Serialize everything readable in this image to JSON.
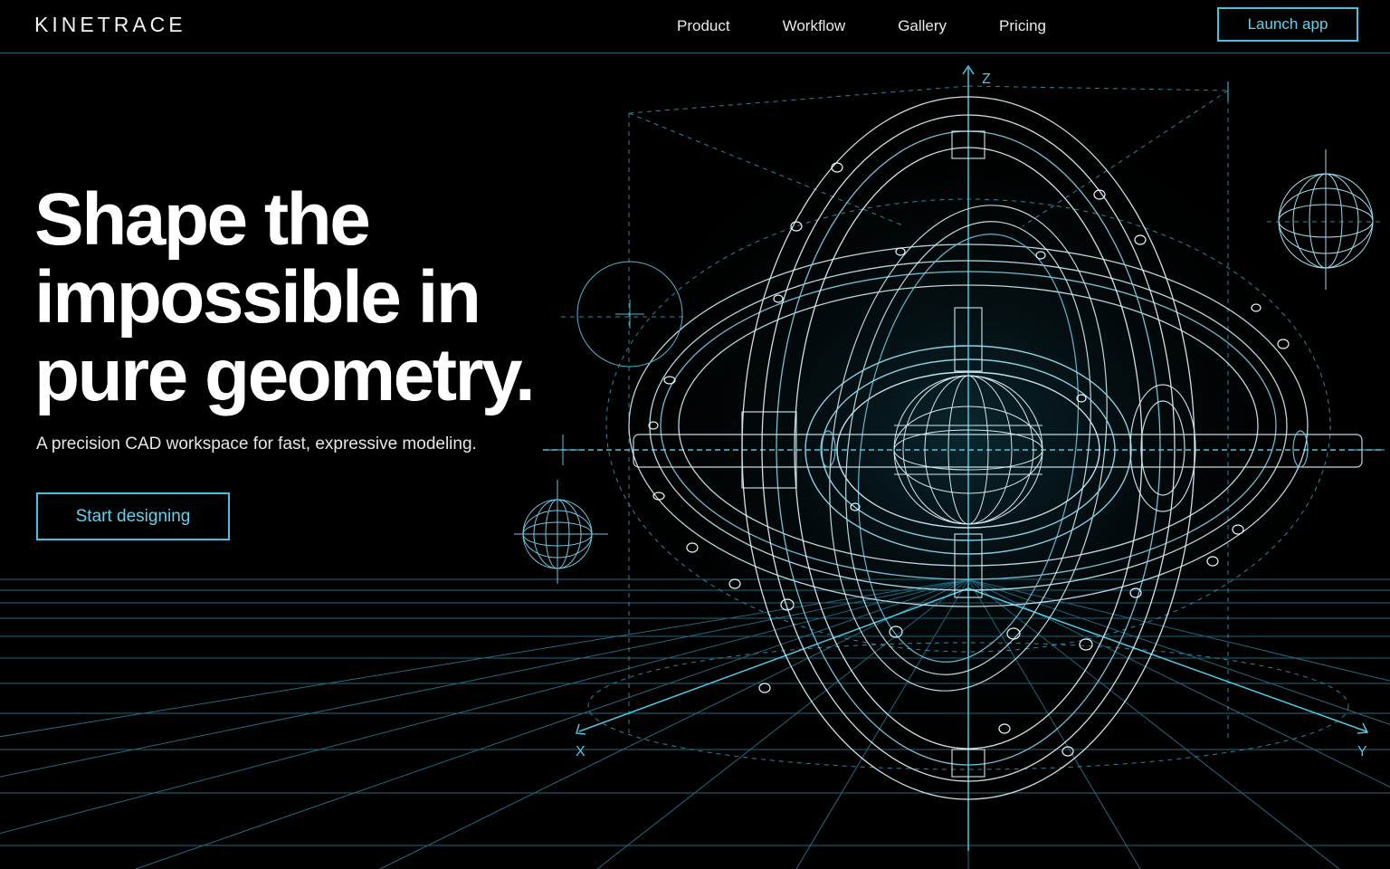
{
  "brand": {
    "name": "KINETRACE"
  },
  "nav": {
    "items": [
      {
        "label": "Product"
      },
      {
        "label": "Workflow"
      },
      {
        "label": "Gallery"
      },
      {
        "label": "Pricing"
      }
    ],
    "launch_label": "Launch app"
  },
  "hero": {
    "title_line1": "Shape the",
    "title_line2": "impossible in",
    "title_line3": "pure geometry.",
    "subtitle": "A precision CAD workspace for fast, expressive modeling.",
    "cta_label": "Start designing"
  },
  "illustration": {
    "axis_x": "X",
    "axis_y": "Y",
    "axis_z": "Z"
  },
  "colors": {
    "background": "#000000",
    "accent": "#46c2de",
    "wireframe": "#9fdcec",
    "text": "#ffffff"
  }
}
